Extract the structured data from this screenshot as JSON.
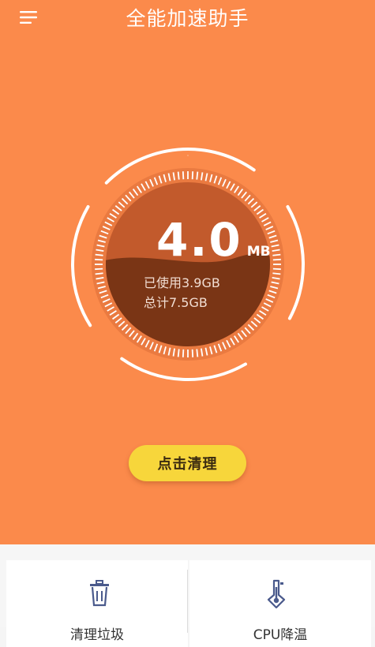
{
  "header": {
    "title": "全能加速助手",
    "menu_icon": "hamburger-menu-icon"
  },
  "memory": {
    "value": "4.0",
    "unit": "MB",
    "used_label": "已使用3.9GB",
    "total_label": "总计7.5GB",
    "used_fraction": 0.52
  },
  "actions": {
    "clean_label": "点击清理"
  },
  "features": [
    {
      "label": "清理垃圾",
      "icon": "trash-icon"
    },
    {
      "label": "CPU降温",
      "icon": "thermometer-icon"
    }
  ],
  "colors": {
    "background": "#fb8a4b",
    "dial_inner": "#c25a2c",
    "liquid": "#7a3515",
    "button": "#f7d63b",
    "icon": "#4a5a8c"
  }
}
